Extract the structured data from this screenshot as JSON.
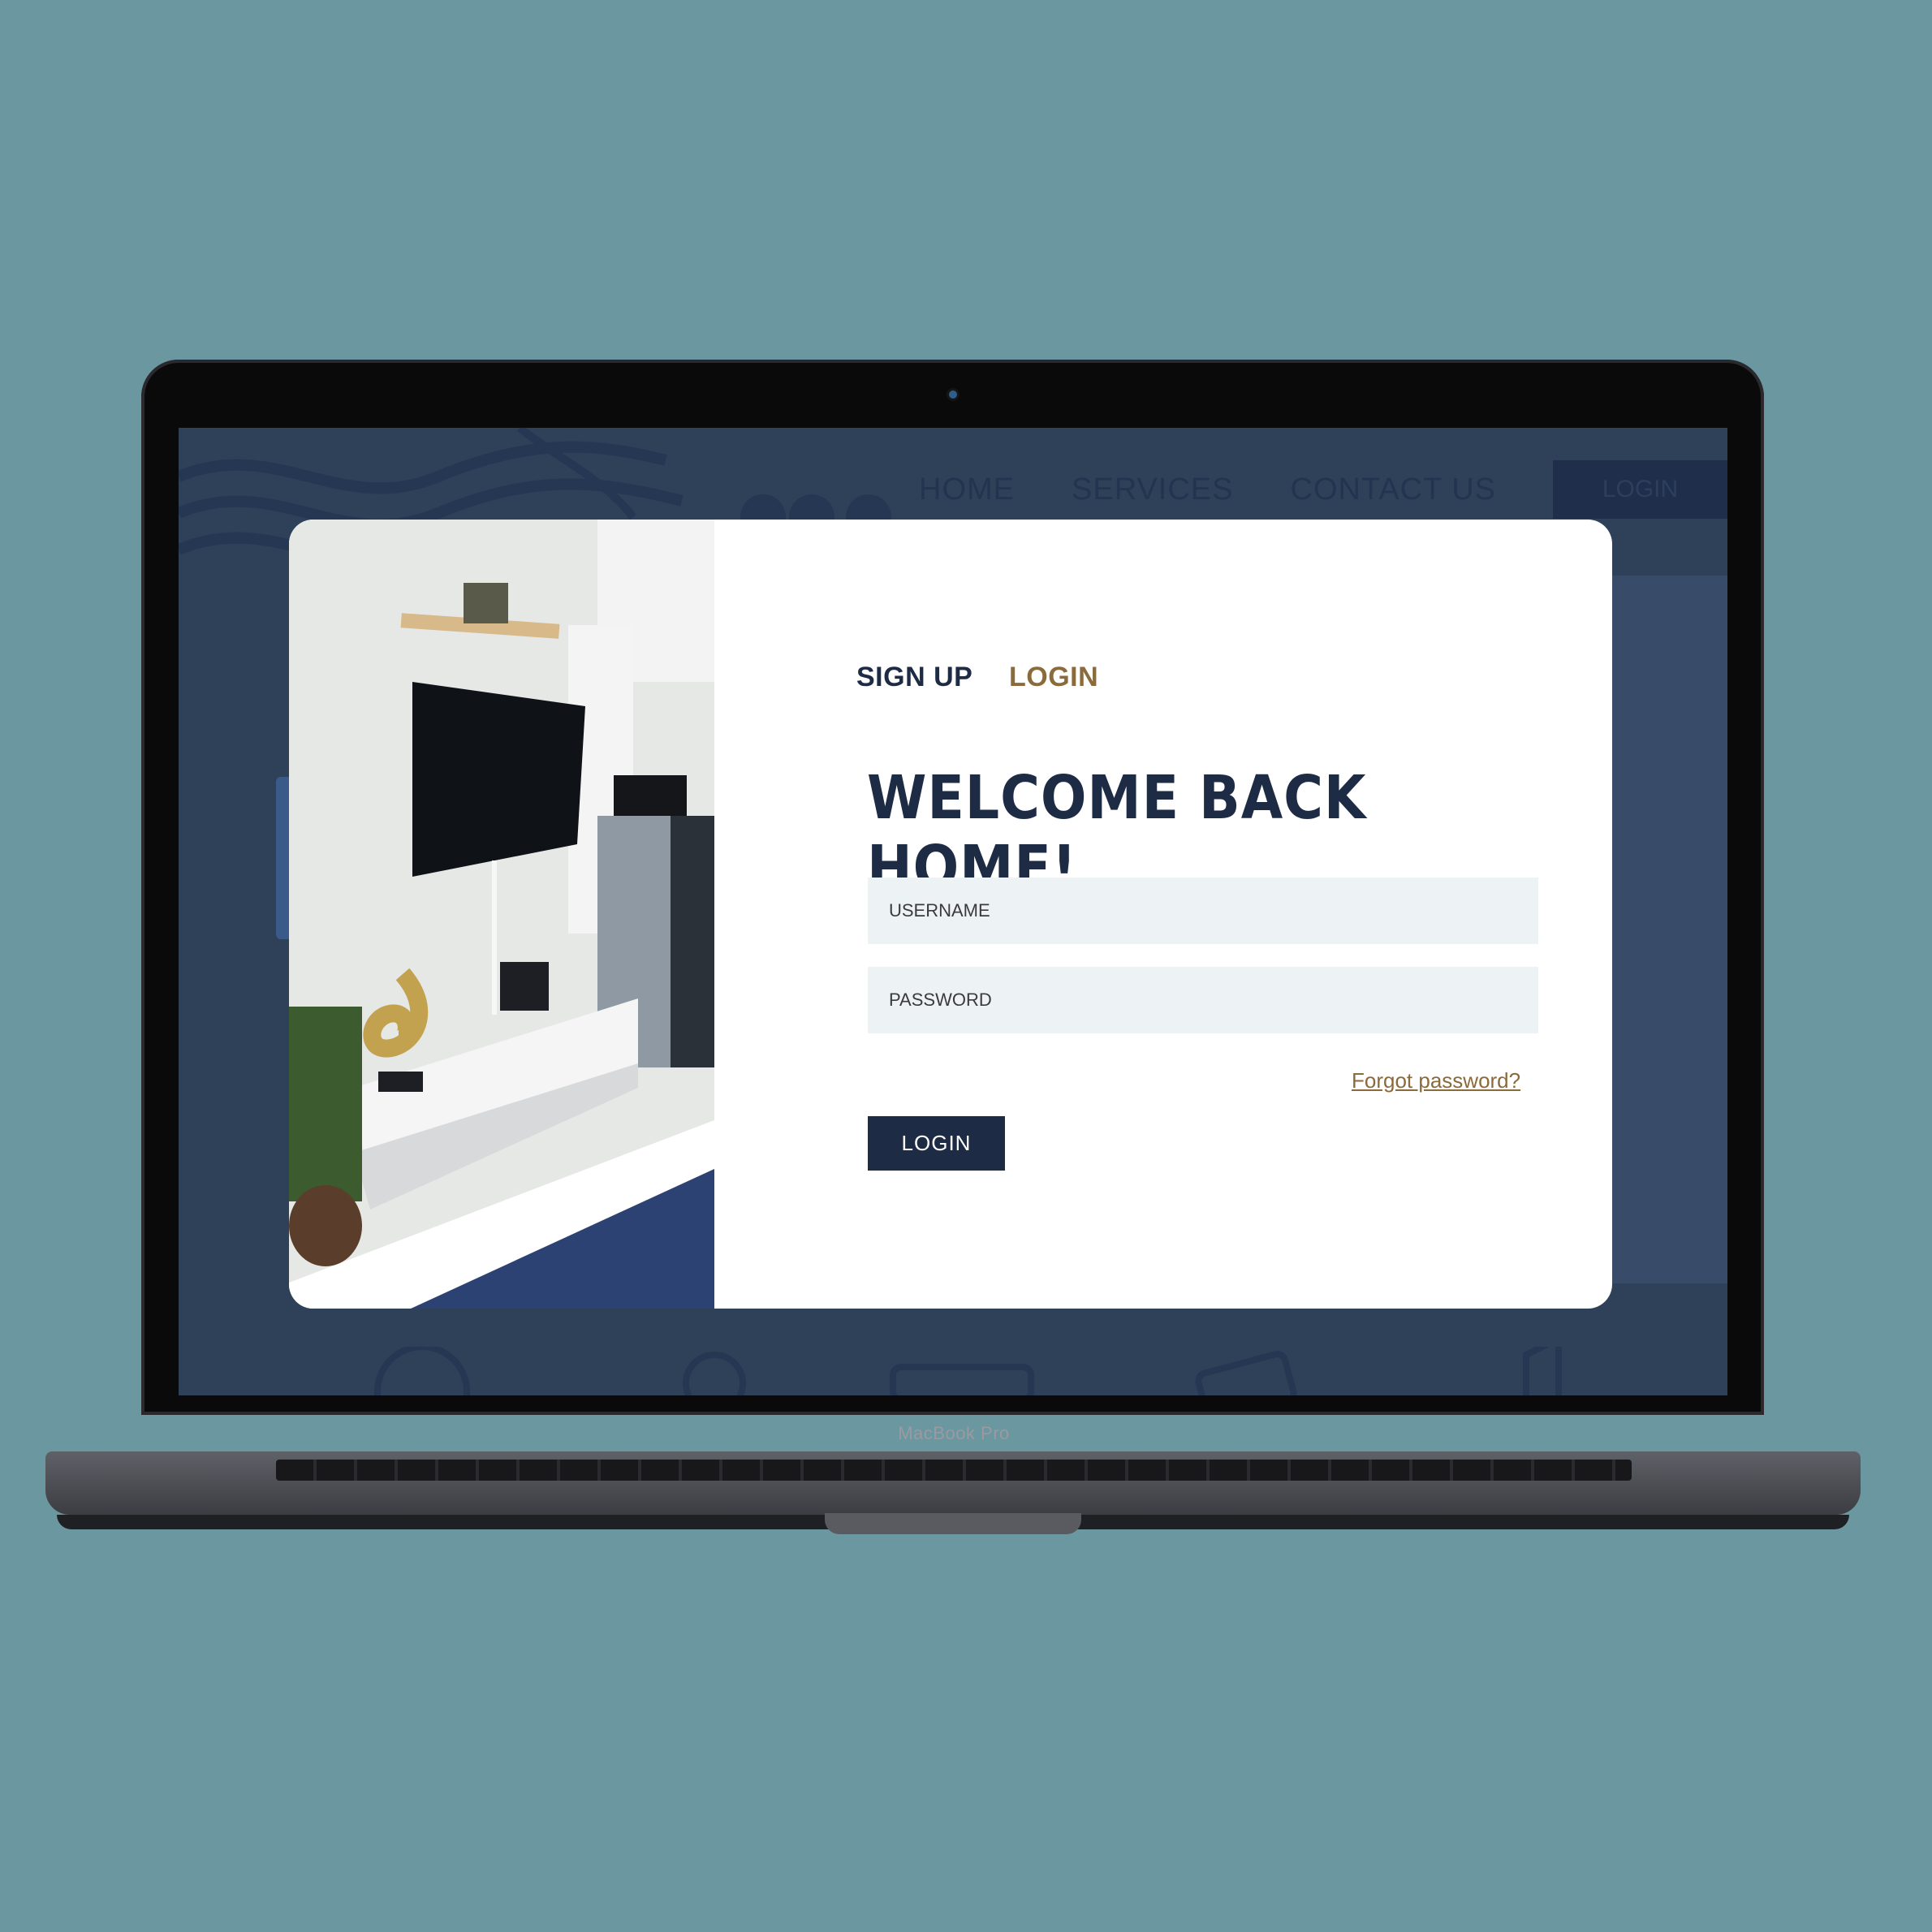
{
  "site": {
    "nav": {
      "items": [
        "HOME",
        "SERVICES",
        "CONTACT US"
      ],
      "login_label": "LOGIN"
    }
  },
  "auth_modal": {
    "tabs": {
      "signup_label": "SIGN UP",
      "login_label": "LOGIN",
      "active": "LOGIN"
    },
    "heading": "WELCOME BACK HOME!",
    "username": {
      "placeholder": "USERNAME",
      "value": ""
    },
    "password": {
      "placeholder": "PASSWORD",
      "value": ""
    },
    "forgot_label": "Forgot password?",
    "submit_label": "LOGIN"
  },
  "device": {
    "label": "MacBook Pro"
  },
  "colors": {
    "backdrop": "#6b98a0",
    "site_background": "#2f4059",
    "navy": "#1d2b45",
    "gold": "#8b6a3b",
    "input_fill": "#edf2f5"
  }
}
